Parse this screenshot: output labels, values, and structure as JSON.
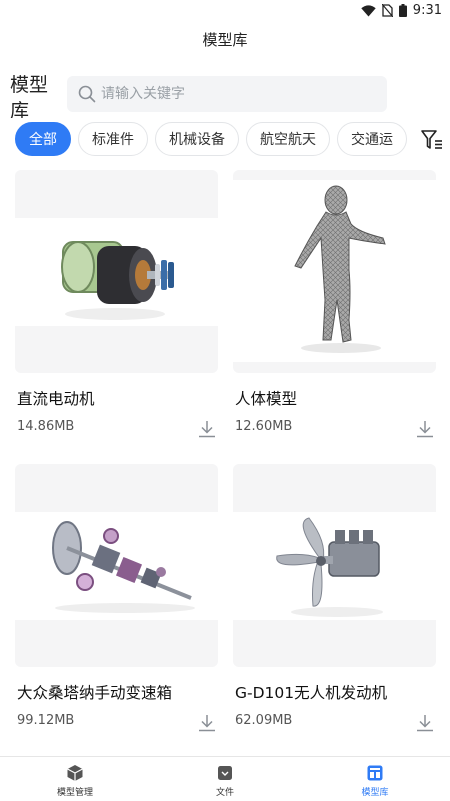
{
  "status_bar": {
    "time": "9:31"
  },
  "header": {
    "title": "模型库"
  },
  "search": {
    "label": "模型库",
    "placeholder": "请输入关键字"
  },
  "categories": [
    "全部",
    "标准件",
    "机械设备",
    "航空航天",
    "交通运"
  ],
  "colors": {
    "accent": "#2f7bf5",
    "card_bg": "#f5f5f6"
  },
  "models": [
    {
      "name": "直流电动机",
      "size": "14.86MB",
      "icon": "dc-motor-model"
    },
    {
      "name": "人体模型",
      "size": "12.60MB",
      "icon": "human-body-model"
    },
    {
      "name": "大众桑塔纳手动变速箱",
      "size": "99.12MB",
      "icon": "gearbox-model"
    },
    {
      "name": "G-D101无人机发动机",
      "size": "62.09MB",
      "icon": "drone-engine-model"
    }
  ],
  "tabs": [
    {
      "label": "模型管理",
      "icon": "cube-icon"
    },
    {
      "label": "文件",
      "icon": "folder-icon"
    },
    {
      "label": "模型库",
      "icon": "library-icon",
      "active": true
    }
  ]
}
